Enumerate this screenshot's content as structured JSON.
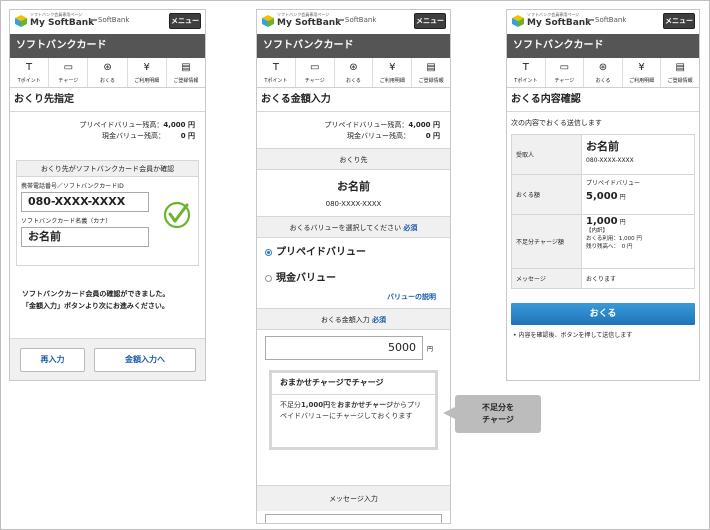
{
  "brand": {
    "small_text": "ソフトバンク会員専用ページ",
    "name": "My SoftBank",
    "softbank": "SoftBank",
    "menu_label": "メニュー"
  },
  "app_title": "ソフトバンクカード",
  "nav": [
    {
      "label": "Tポイント",
      "icon": "T"
    },
    {
      "label": "チャージ",
      "icon": "▭"
    },
    {
      "label": "おくる",
      "icon": "⊛"
    },
    {
      "label": "ご利用明細",
      "icon": "¥"
    },
    {
      "label": "ご登録情報",
      "icon": "▤"
    }
  ],
  "screen1": {
    "title": "おくり先指定",
    "prepaid_label": "プリペイドバリュー残高：",
    "prepaid_value": "4,000 円",
    "cash_label": "現金バリュー残高：",
    "cash_value": "0 円",
    "confirm_header": "おくり先がソフトバンクカード会員か確認",
    "phone_label": "携帯電話番号／ソフトバンクカードID",
    "phone_value": "080-XXXX-XXXX",
    "name_label": "ソフトバンクカード名義（カナ）",
    "name_value": "お名前",
    "message_line1": "ソフトバンクカード会員の確認ができました。",
    "message_line2": "「金額入力」ボタンより次にお進みください。",
    "reenter_button": "再入力",
    "amount_button": "金額入力へ"
  },
  "screen2": {
    "title": "おくる金額入力",
    "prepaid_label": "プリペイドバリュー残高：",
    "prepaid_value": "4,000 円",
    "cash_label": "現金バリュー残高：",
    "cash_value": "0 円",
    "dest_header": "おくり先",
    "dest_name": "お名前",
    "dest_phone": "080-XXXX-XXXX",
    "value_select_header": "おくるバリューを選択してください",
    "required": "必須",
    "option_prepaid": "プリペイドバリュー",
    "option_cash": "現金バリュー",
    "value_help_link": "バリューの説明",
    "amount_header": "おくる金額入力",
    "amount_value": "5000",
    "amount_unit": "円",
    "auto_charge_title": "おまかせチャージでチャージ",
    "auto_charge_desc_1": "不足分",
    "auto_charge_desc_amount": "1,000円",
    "auto_charge_desc_2": "を",
    "auto_charge_desc_bold": "おまかせチャージ",
    "auto_charge_desc_3": "からプリペイドバリューにチャージしておくります",
    "message_header": "メッセージ入力"
  },
  "callout": {
    "line1": "不足分を",
    "line2": "チャージ"
  },
  "screen3": {
    "title": "おくる内容確認",
    "intro": "次の内容でおくる送信します",
    "rows": {
      "recipient_label": "受取人",
      "recipient_name": "お名前",
      "recipient_phone": "080-XXXX-XXXX",
      "amount_label": "おくる額",
      "amount_type": "プリペイドバリュー",
      "amount_value": "5,000",
      "amount_unit": "円",
      "shortfall_label": "不足分チャージ額",
      "shortfall_value": "1,000",
      "shortfall_unit": "円",
      "breakdown_title": "【内訳】",
      "breakdown_use": "おくる利用：1,000 円",
      "breakdown_remaining": "残り残高へ：　0 円",
      "message_label": "メッセージ",
      "message_value": "おくります"
    },
    "send_button": "おくる",
    "note": "内容を確認後、ボタンを押して送信します"
  },
  "colors": {
    "titlebar": "#555555",
    "send_button": "#2a86c9",
    "check": "#6ab42d",
    "link_blue": "#1a5aa8"
  }
}
